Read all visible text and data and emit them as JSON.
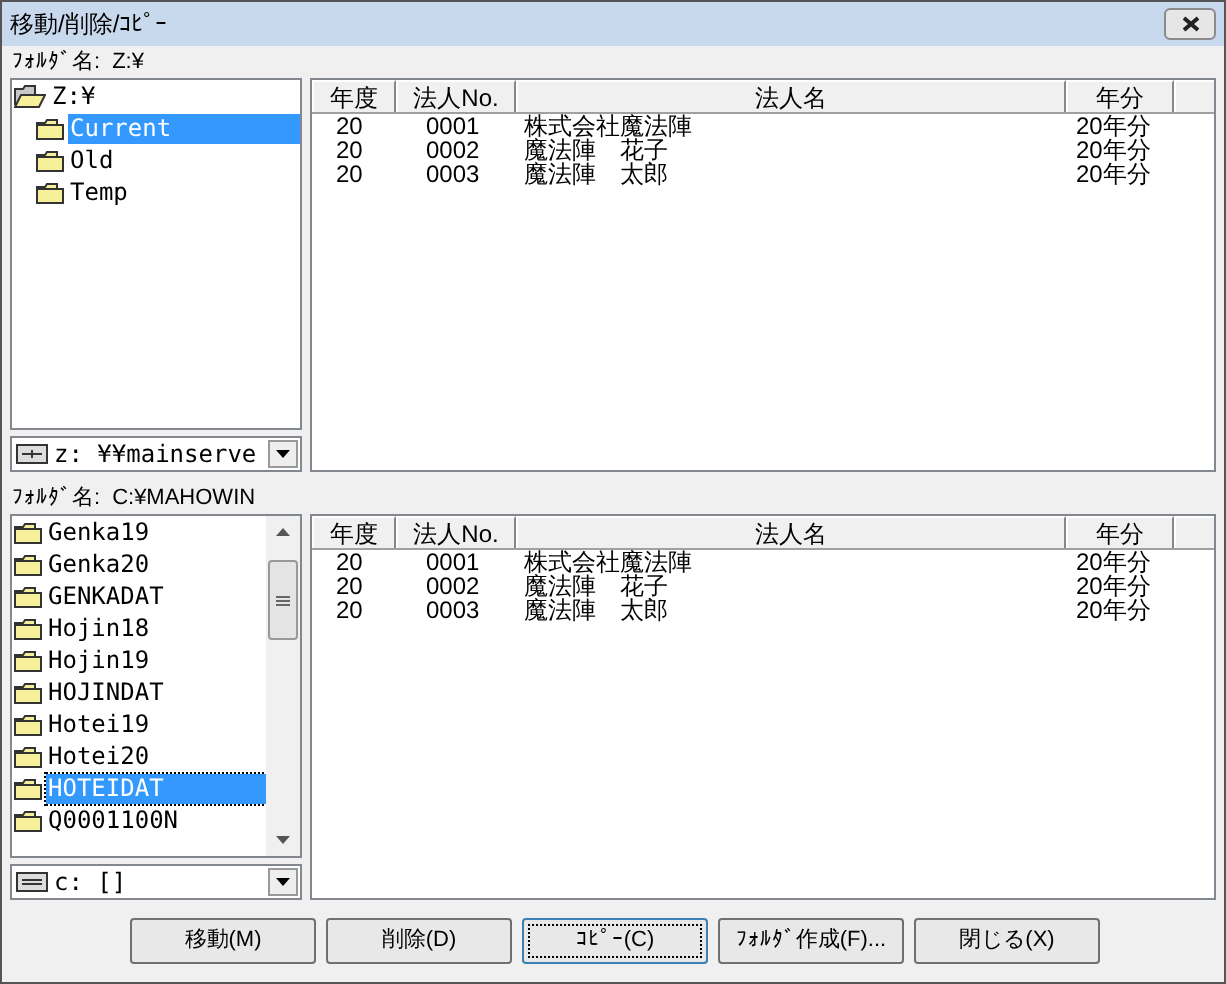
{
  "window": {
    "title": "移動/削除/ｺﾋﾟｰ"
  },
  "panes": [
    {
      "folder_label": "ﾌｫﾙﾀﾞ名:",
      "folder_path": "Z:¥",
      "tree": [
        {
          "label": "Z:¥",
          "kind": "open",
          "selected": false,
          "children": [
            {
              "label": "Current",
              "kind": "folder",
              "selected": true
            },
            {
              "label": "Old",
              "kind": "folder",
              "selected": false
            },
            {
              "label": "Temp",
              "kind": "folder",
              "selected": false
            }
          ]
        }
      ],
      "scrollbar": false,
      "drive": {
        "kind": "network",
        "label": "z: ¥¥mainserve"
      },
      "columns": [
        "年度",
        "法人No.",
        "法人名",
        "年分"
      ],
      "rows": [
        [
          "20",
          "0001",
          "株式会社魔法陣",
          "20年分"
        ],
        [
          "20",
          "0002",
          "魔法陣　花子",
          "20年分"
        ],
        [
          "20",
          "0003",
          "魔法陣　太郎",
          "20年分"
        ]
      ]
    },
    {
      "folder_label": "ﾌｫﾙﾀﾞ名:",
      "folder_path": "C:¥MAHOWIN",
      "tree": [
        {
          "label": "Genka19",
          "kind": "folder",
          "selected": false
        },
        {
          "label": "Genka20",
          "kind": "folder",
          "selected": false
        },
        {
          "label": "GENKADAT",
          "kind": "folder",
          "selected": false
        },
        {
          "label": "Hojin18",
          "kind": "folder",
          "selected": false
        },
        {
          "label": "Hojin19",
          "kind": "folder",
          "selected": false
        },
        {
          "label": "HOJINDAT",
          "kind": "folder",
          "selected": false
        },
        {
          "label": "Hotei19",
          "kind": "folder",
          "selected": false
        },
        {
          "label": "Hotei20",
          "kind": "folder",
          "selected": false
        },
        {
          "label": "HOTEIDAT",
          "kind": "folder",
          "selected": true
        },
        {
          "label": "Q0001100N",
          "kind": "folder",
          "selected": false
        }
      ],
      "scrollbar": true,
      "drive": {
        "kind": "local",
        "label": "c: []"
      },
      "columns": [
        "年度",
        "法人No.",
        "法人名",
        "年分"
      ],
      "rows": [
        [
          "20",
          "0001",
          "株式会社魔法陣",
          "20年分"
        ],
        [
          "20",
          "0002",
          "魔法陣　花子",
          "20年分"
        ],
        [
          "20",
          "0003",
          "魔法陣　太郎",
          "20年分"
        ]
      ]
    }
  ],
  "buttons": [
    {
      "label": "移動(M)",
      "focused": false
    },
    {
      "label": "削除(D)",
      "focused": false
    },
    {
      "label": "ｺﾋﾟｰ(C)",
      "focused": true
    },
    {
      "label": "ﾌｫﾙﾀﾞ作成(F)...",
      "focused": false
    },
    {
      "label": "閉じる(X)",
      "focused": false
    }
  ]
}
